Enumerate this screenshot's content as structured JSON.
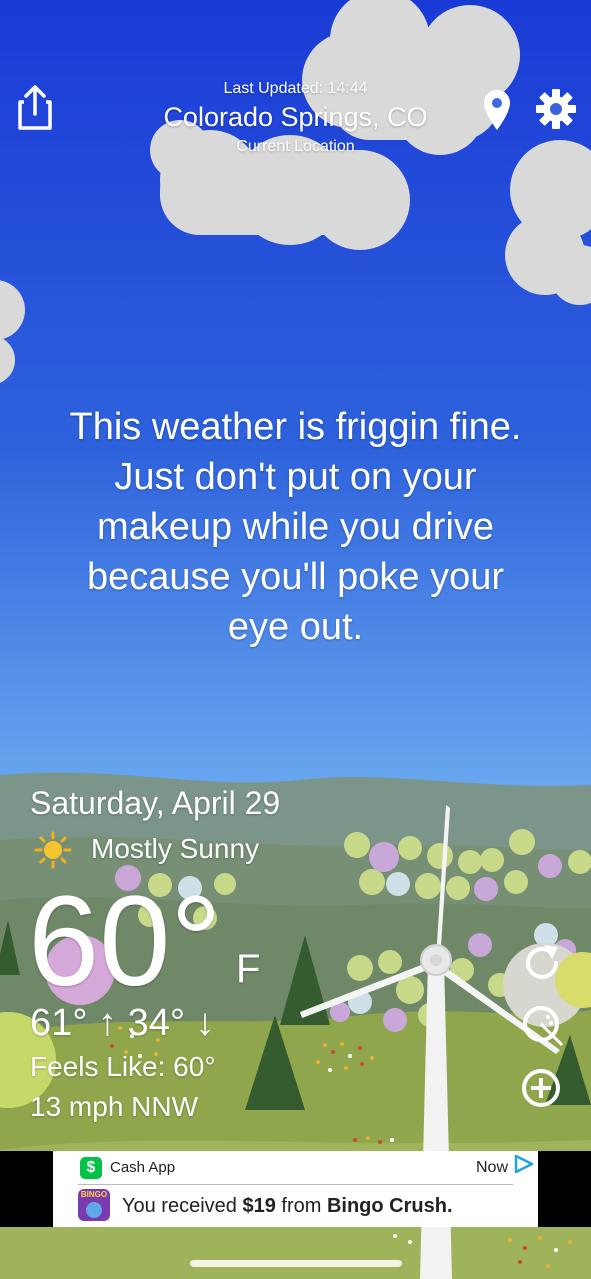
{
  "header": {
    "last_updated": "Last Updated: 14:44",
    "location": "Colorado Springs, CO",
    "location_sub": "Current Location"
  },
  "message": {
    "lines": [
      "This weather is friggin fine.",
      "Just don't put on your",
      "makeup while you drive",
      "because you'll poke your",
      "eye out."
    ]
  },
  "weather": {
    "date": "Saturday, April 29",
    "condition": "Mostly Sunny",
    "temperature": "60°",
    "unit": "F",
    "high": "61°",
    "high_arrow": "↑",
    "low": "34°",
    "low_arrow": "↓",
    "feels_like": "Feels Like: 60°",
    "wind": "13 mph NNW"
  },
  "icons": {
    "share": "share-icon",
    "location": "location-pin-icon",
    "settings": "gear-icon",
    "refresh": "refresh-icon",
    "radar": "radar-icon",
    "add": "plus-circle-icon",
    "condition": "sun-icon"
  },
  "ad": {
    "advertiser": "Cash App",
    "cta": "Now",
    "message_prefix": "You received ",
    "amount": "$19",
    "message_mid": " from ",
    "sender": "Bingo Crush.",
    "app_icon_text": "BINGO"
  },
  "colors": {
    "sky_top": "#1a3fd4",
    "sky_bottom": "#6aa8f0",
    "hill_far": "#7f9c8a",
    "grass": "#8fa74a",
    "cashapp_green": "#00c244"
  }
}
